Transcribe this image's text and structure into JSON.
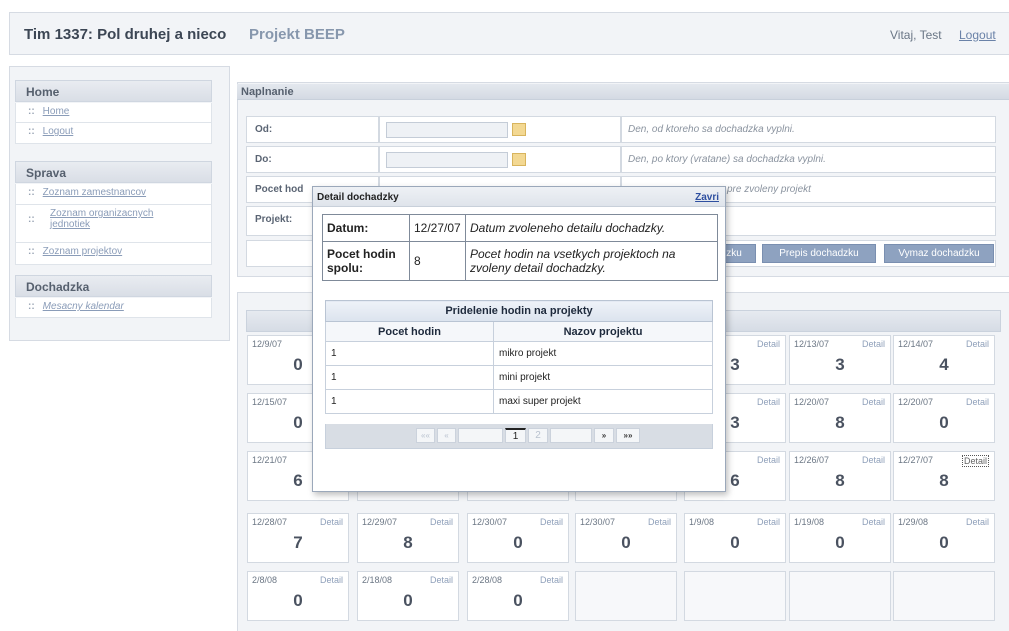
{
  "header": {
    "app_title": "Tim 1337: Pol druhej a nieco",
    "project_title": "Projekt BEEP",
    "welcome": "Vitaj, Test",
    "logout": "Logout"
  },
  "sidebar": {
    "sections": [
      {
        "title": "Home",
        "items": [
          {
            "label": "Home"
          },
          {
            "label": "Logout"
          }
        ]
      },
      {
        "title": "Sprava",
        "items": [
          {
            "label": "Zoznam zamestnancov"
          },
          {
            "label": "Zoznam organizacnych jednotiek"
          },
          {
            "label": "Zoznam projektov"
          }
        ]
      },
      {
        "title": "Dochadzka",
        "items": [
          {
            "label": "Mesacny kalendar"
          }
        ]
      }
    ]
  },
  "form": {
    "title": "Naplnanie",
    "od_label": "Od:",
    "od_desc": "Den, od ktoreho sa dochadzka vyplni.",
    "do_label": "Do:",
    "do_desc": "Den, po ktory (vratane) sa dochadzka vyplni.",
    "pocet_label": "Pocet hod",
    "pocet_desc": "pre zvoleny projekt",
    "projekt_label": "Projekt:",
    "btn_partial": "zku",
    "btn_prepis": "Prepis dochadzku",
    "btn_vymaz": "Vymaz dochadzku"
  },
  "calendar": {
    "detail_label": "Detail",
    "rows": [
      [
        {
          "date": "12/9/07",
          "hours": "0"
        },
        null,
        null,
        null,
        {
          "date": "7",
          "hours": "3"
        },
        {
          "date": "12/13/07",
          "hours": "3"
        },
        {
          "date": "12/14/07",
          "hours": "4"
        }
      ],
      [
        {
          "date": "12/15/07",
          "hours": "0"
        },
        null,
        null,
        null,
        {
          "date": "7",
          "hours": "3"
        },
        {
          "date": "12/20/07",
          "hours": "8"
        },
        {
          "date": "12/20/07",
          "hours": "0"
        }
      ],
      [
        {
          "date": "12/21/07",
          "hours": "6"
        },
        null,
        null,
        null,
        {
          "date": "7",
          "hours": "6"
        },
        {
          "date": "12/26/07",
          "hours": "8"
        },
        {
          "date": "12/27/07",
          "hours": "8"
        }
      ],
      [
        {
          "date": "12/28/07",
          "hours": "7"
        },
        {
          "date": "12/29/07",
          "hours": "8"
        },
        {
          "date": "12/30/07",
          "hours": "0"
        },
        {
          "date": "12/30/07",
          "hours": "0"
        },
        {
          "date": "1/9/08",
          "hours": "0"
        },
        {
          "date": "1/19/08",
          "hours": "0"
        },
        {
          "date": "1/29/08",
          "hours": "0"
        }
      ],
      [
        {
          "date": "2/8/08",
          "hours": "0"
        },
        {
          "date": "2/18/08",
          "hours": "0"
        },
        {
          "date": "2/28/08",
          "hours": "0"
        },
        null,
        null,
        null,
        null
      ]
    ]
  },
  "modal": {
    "title": "Detail dochadzky",
    "close": "Zavri",
    "datum_label": "Datum:",
    "datum_value": "12/27/07",
    "datum_desc": "Datum zvoleneho detailu dochadzky.",
    "pocet_label": "Pocet hodin spolu:",
    "pocet_value": "8",
    "pocet_desc": "Pocet hodin na vsetkych projektoch na zvoleny detail dochadzky.",
    "projects_caption": "Pridelenie hodin na projekty",
    "col_hours": "Pocet hodin",
    "col_name": "Nazov projektu",
    "projects": [
      {
        "hours": "1",
        "name": "mikro projekt"
      },
      {
        "hours": "1",
        "name": "mini projekt"
      },
      {
        "hours": "1",
        "name": "maxi super projekt"
      }
    ],
    "pager": {
      "first": "««",
      "prev": "«",
      "page1": "1",
      "page2": "2",
      "next": "»",
      "last": "»»"
    }
  }
}
